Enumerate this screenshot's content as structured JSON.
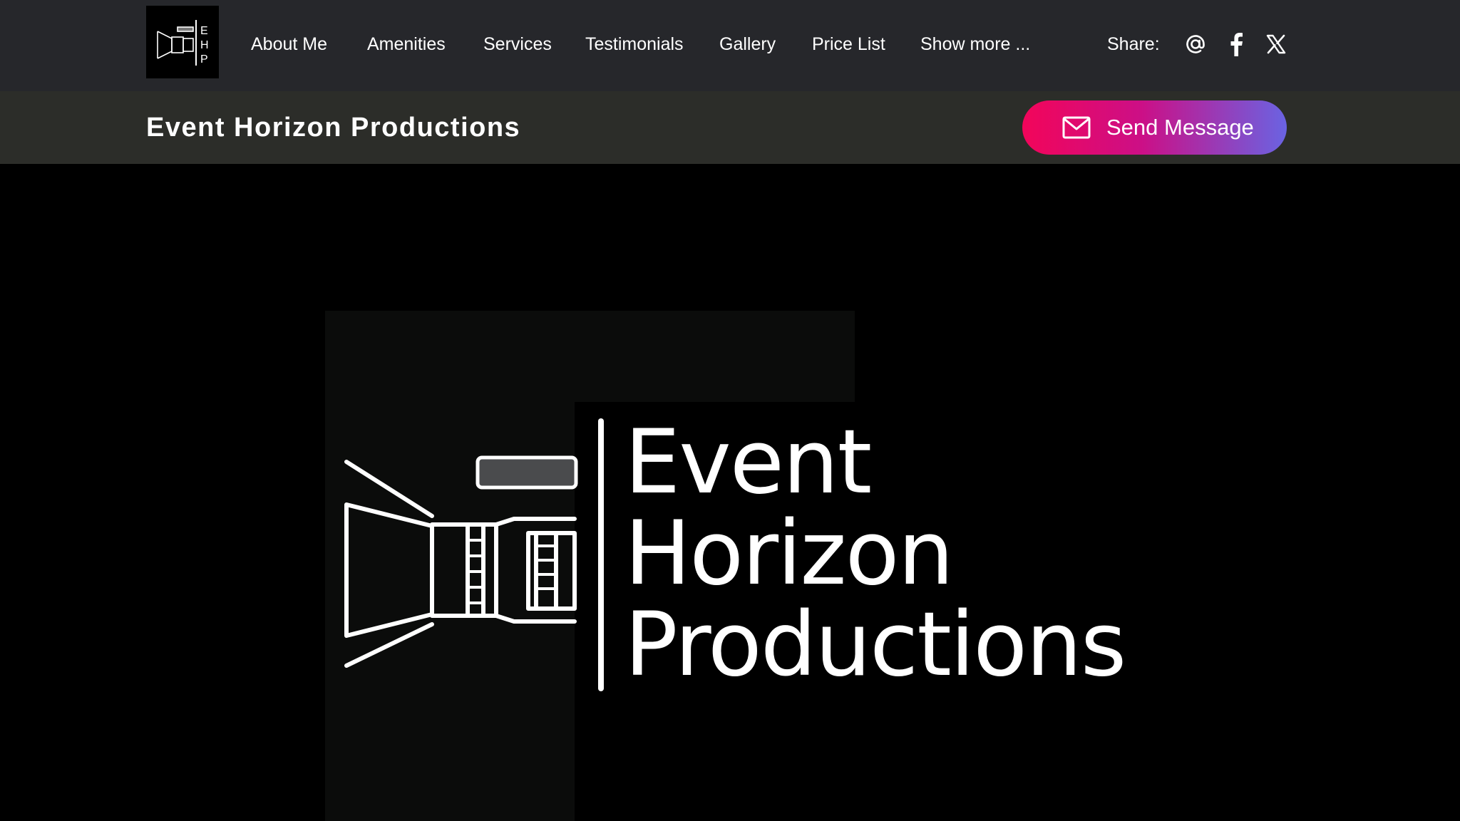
{
  "header": {
    "logo_letters": [
      "E",
      "H",
      "P"
    ],
    "nav": [
      {
        "label": "About Me"
      },
      {
        "label": "Amenities"
      },
      {
        "label": "Services"
      },
      {
        "label": "Testimonials"
      },
      {
        "label": "Gallery"
      },
      {
        "label": "Price List"
      },
      {
        "label": "Show more ..."
      }
    ],
    "share_label": "Share:",
    "share_icons": [
      "at-sign-icon",
      "facebook-icon",
      "x-twitter-icon"
    ]
  },
  "subheader": {
    "title": "Event Horizon Productions",
    "send_button_label": "Send Message",
    "send_button_icon": "mail-icon"
  },
  "hero": {
    "logo_lines": [
      "Event",
      "Horizon",
      "Productions"
    ]
  },
  "colors": {
    "nav_background": "#26272b",
    "subheader_background": "#2c2d29",
    "button_gradient_start": "#f2055a",
    "button_gradient_end": "#6a63e2",
    "hero_background": "#000000"
  }
}
